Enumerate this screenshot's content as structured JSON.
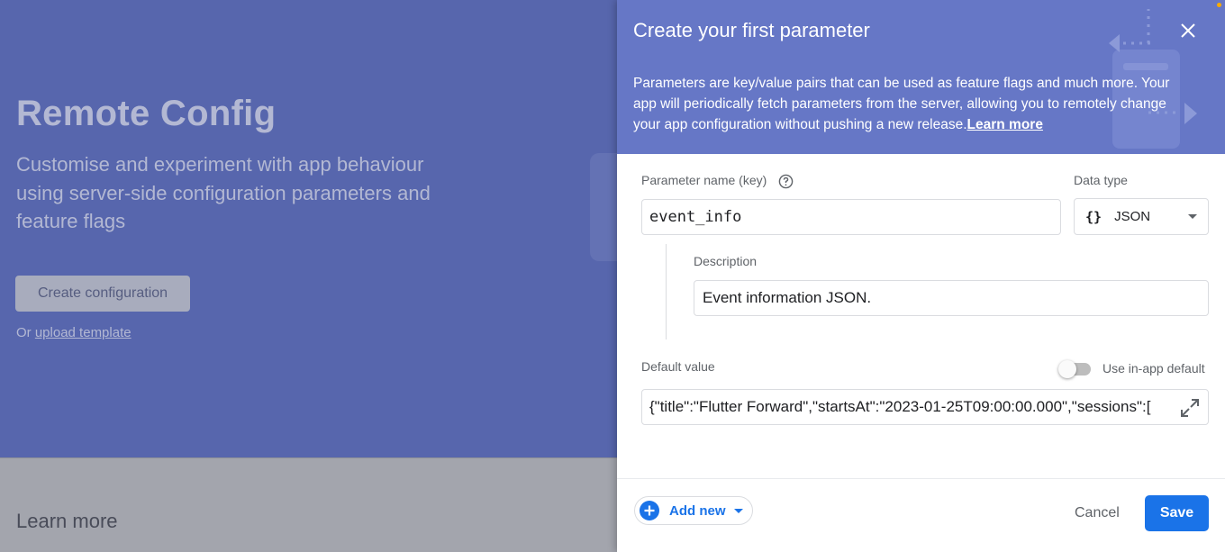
{
  "background": {
    "title": "Remote Config",
    "subtitle": "Customise and experiment with app behaviour using server-side configuration parameters and feature flags",
    "create_button": "Create configuration",
    "upload_prefix": "Or",
    "upload_link": "upload template",
    "learn_more_heading": "Learn more"
  },
  "dialog": {
    "title": "Create your first parameter",
    "description": "Parameters are key/value pairs that can be used as feature flags and much more. Your app will periodically fetch parameters from the server, allowing you to remotely change your app configuration without pushing a new release.",
    "learn_more_link": "Learn more",
    "close_icon": "close-icon",
    "parameter_name_label": "Parameter name (key)",
    "parameter_name_value": "event_info",
    "data_type_label": "Data type",
    "data_type_icon": "{}",
    "data_type_value": "JSON",
    "description_label": "Description",
    "description_value": "Event information JSON.",
    "default_value_label": "Default value",
    "use_in_app_default_label": "Use in-app default",
    "use_in_app_default_on": false,
    "default_value": "{\"title\":\"Flutter Forward\",\"startsAt\":\"2023-01-25T09:00:00.000\",\"sessions\":[",
    "add_new_label": "Add new",
    "cancel_label": "Cancel",
    "save_label": "Save"
  },
  "colors": {
    "header_bg": "#6677c6",
    "hero_bg": "#5766ad",
    "primary_blue": "#1a73e8"
  }
}
